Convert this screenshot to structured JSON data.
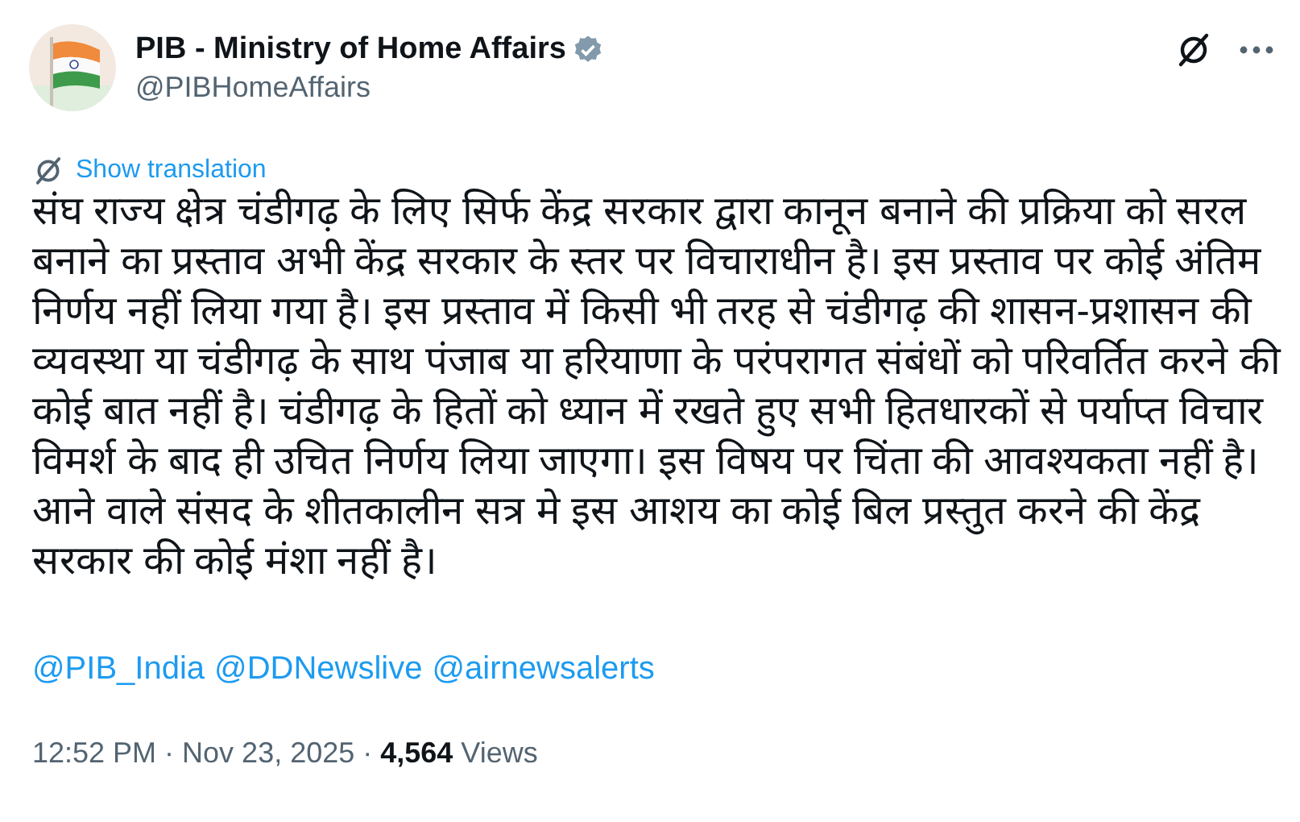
{
  "author": {
    "name": "PIB - Ministry of Home Affairs",
    "handle": "@PIBHomeAffairs",
    "verified": true
  },
  "translation_link": "Show translation",
  "body": "संघ राज्य क्षेत्र चंडीगढ़ के लिए सिर्फ केंद्र सरकार द्वारा कानून बनाने की प्रक्रिया को सरल बनाने का प्रस्ताव अभी केंद्र सरकार के स्तर पर विचाराधीन है। इस प्रस्ताव पर कोई अंतिम निर्णय नहीं लिया गया है। इस प्रस्ताव में किसी भी तरह से चंडीगढ़ की शासन-प्रशासन की व्यवस्था या चंडीगढ़ के साथ पंजाब या हरियाणा के परंपरागत संबंधों को परिवर्तित करने की कोई बात नहीं है। चंडीगढ़ के हितों को ध्यान में रखते हुए सभी हितधारकों से पर्याप्त विचार विमर्श के बाद ही उचित निर्णय लिया जाएगा। इस विषय पर चिंता की आवश्यकता नहीं है। आने वाले संसद के शीतकालीन सत्र मे इस आशय का कोई बिल प्रस्तुत करने की केंद्र सरकार की कोई मंशा नहीं है।",
  "mentions": [
    "@PIB_India",
    "@DDNewslive",
    "@airnewsalerts"
  ],
  "meta": "12:52 PM · Nov 23, 2025 · **4,564** Views"
}
